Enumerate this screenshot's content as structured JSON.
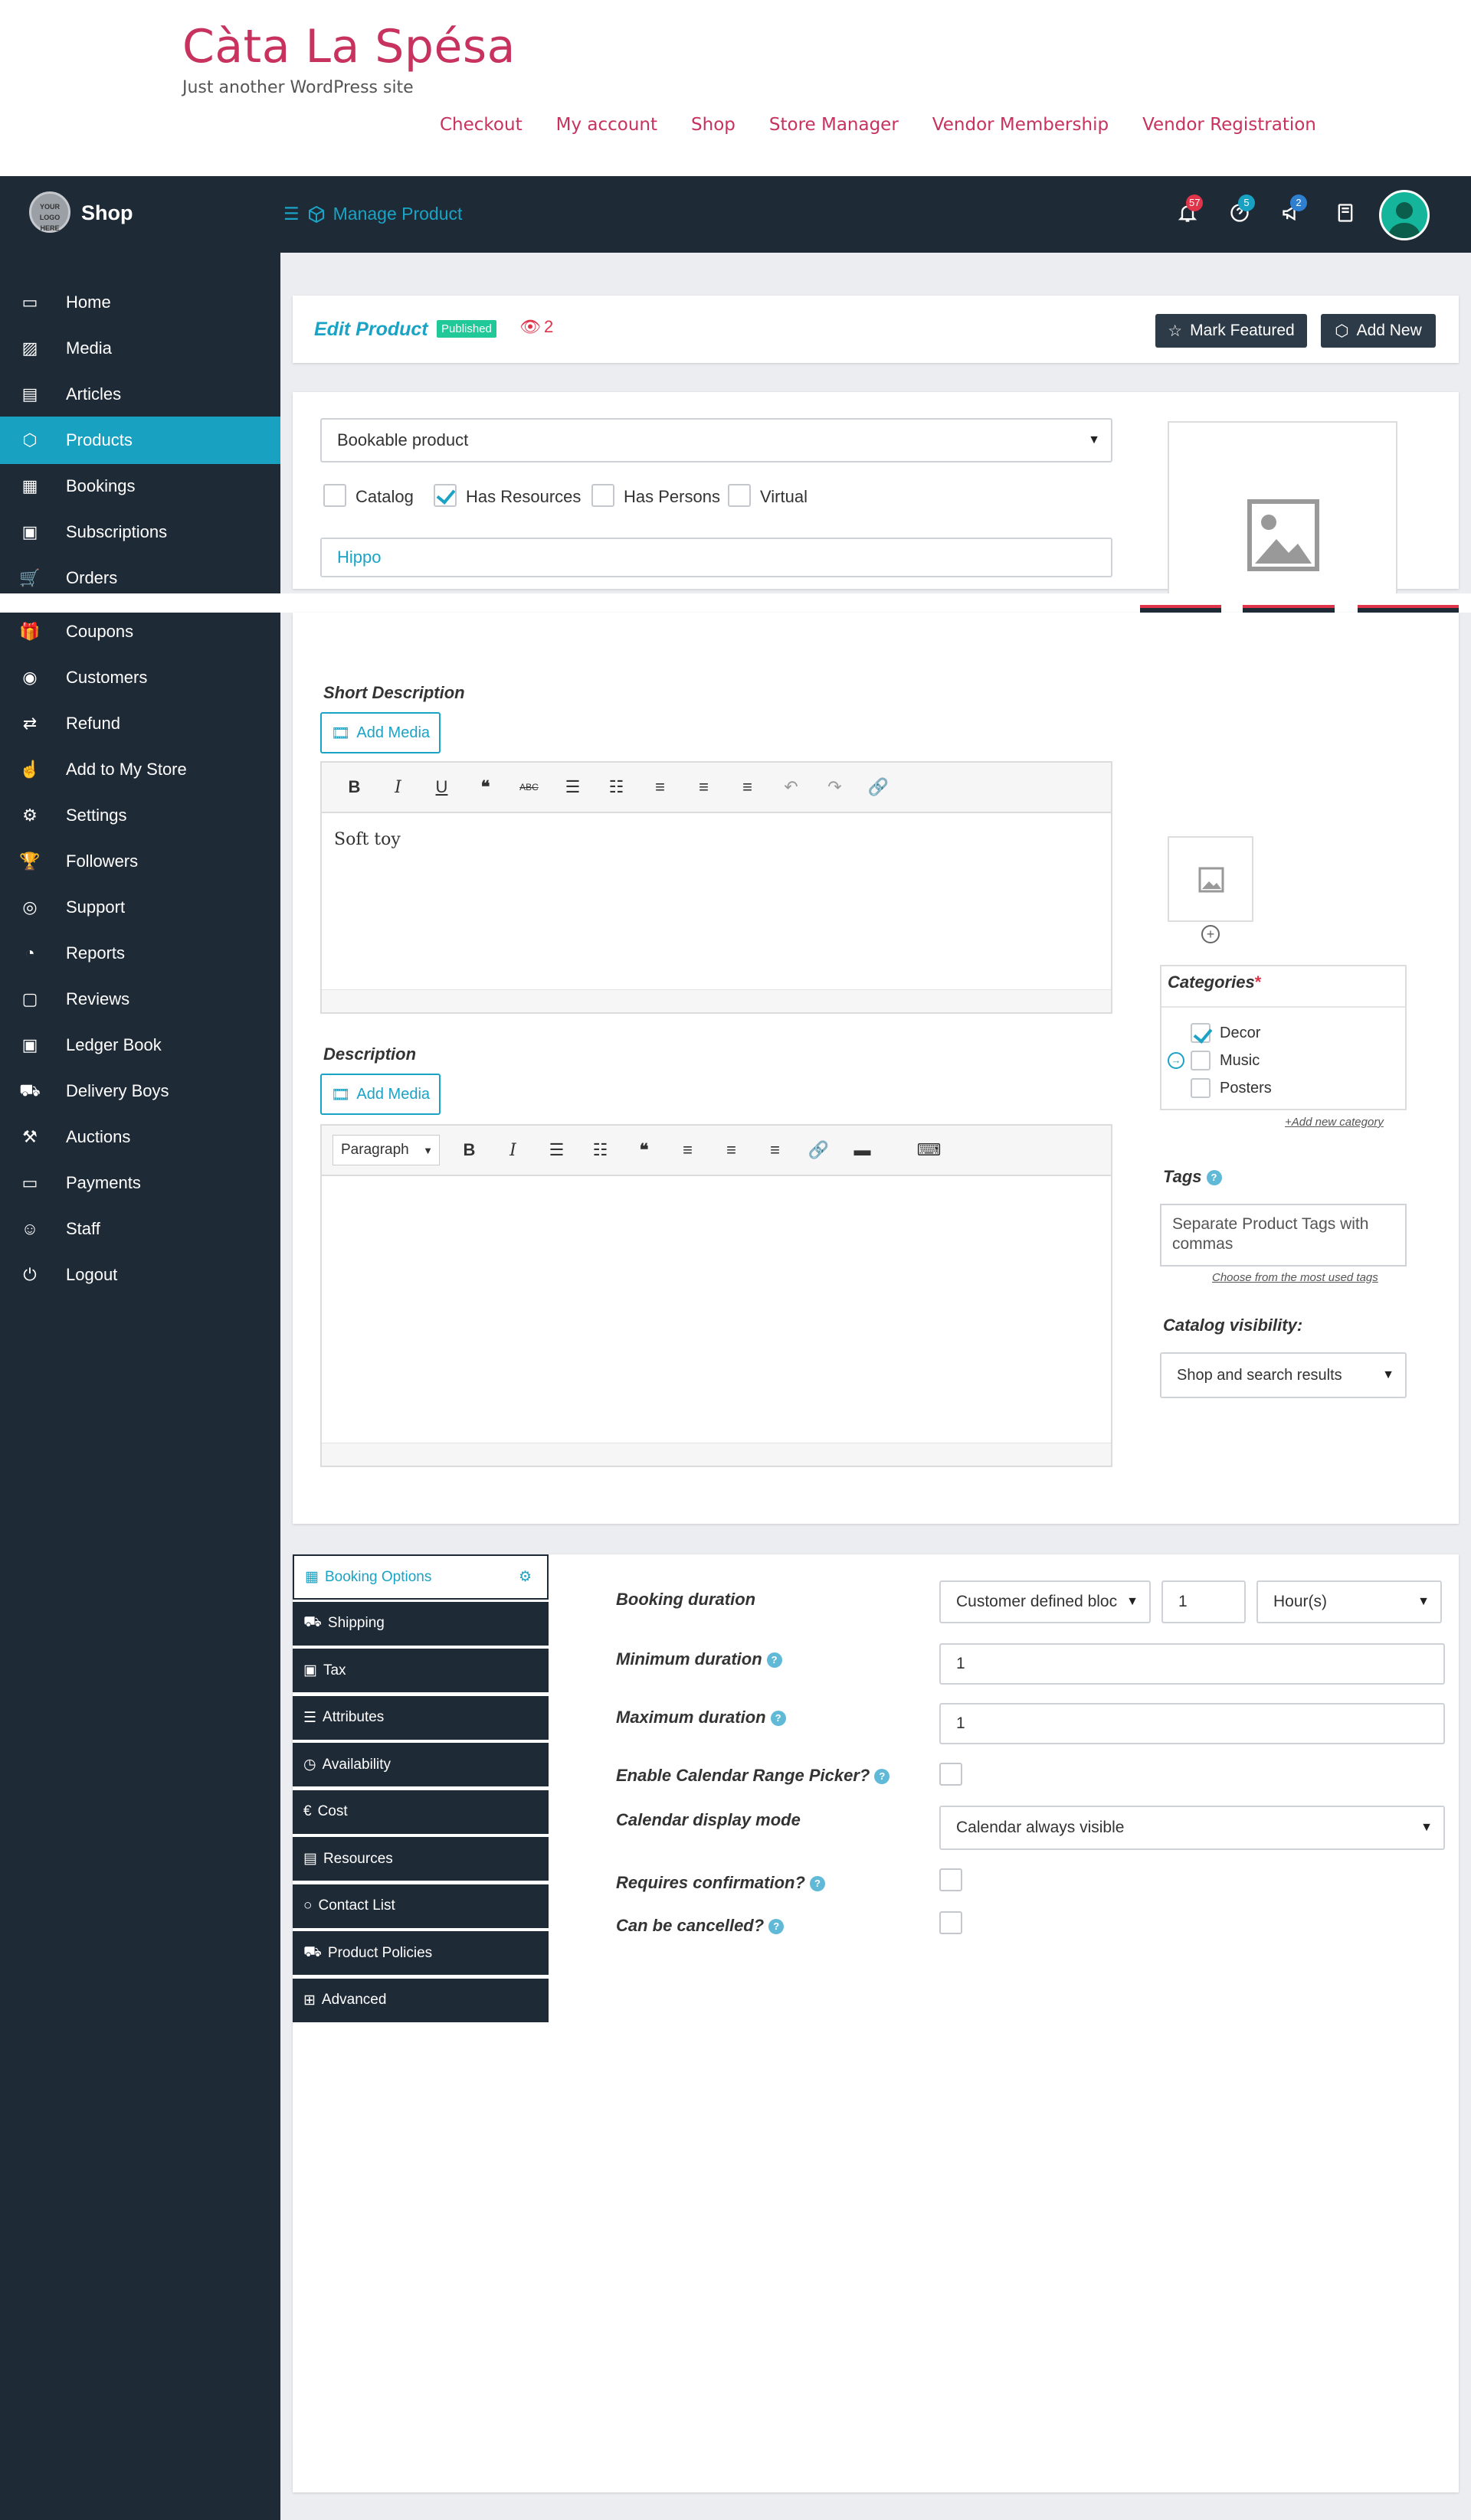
{
  "site": {
    "title": "Càta La Spésa",
    "tagline": "Just another WordPress site",
    "nav": [
      "Checkout",
      "My account",
      "Shop",
      "Store Manager",
      "Vendor Membership",
      "Vendor Registration"
    ]
  },
  "topbar": {
    "logo_text": "YOUR LOGO HERE",
    "shop_label": "Shop",
    "manage_label": "Manage Product",
    "notifications_count": "57",
    "help_count": "5",
    "announce_count": "2",
    "colors": {
      "dark": "#1f2a37",
      "accent": "#1aa3c4",
      "red": "#e0344b",
      "brand": "#c7325e"
    }
  },
  "sidebar": {
    "items": [
      {
        "label": "Home",
        "icon": "monitor-icon"
      },
      {
        "label": "Media",
        "icon": "image-icon"
      },
      {
        "label": "Articles",
        "icon": "document-icon"
      },
      {
        "label": "Products",
        "icon": "cube-icon",
        "active": true
      },
      {
        "label": "Bookings",
        "icon": "calendar-icon"
      },
      {
        "label": "Subscriptions",
        "icon": "money-icon"
      },
      {
        "label": "Orders",
        "icon": "cart-icon"
      },
      {
        "label": "Coupons",
        "icon": "gift-icon"
      },
      {
        "label": "Customers",
        "icon": "user-circle-icon"
      },
      {
        "label": "Refund",
        "icon": "retweet-icon"
      },
      {
        "label": "Add to My Store",
        "icon": "hand-icon"
      },
      {
        "label": "Settings",
        "icon": "cogs-icon"
      },
      {
        "label": "Followers",
        "icon": "trophy-icon"
      },
      {
        "label": "Support",
        "icon": "lifebuoy-icon"
      },
      {
        "label": "Reports",
        "icon": "pie-chart-icon"
      },
      {
        "label": "Reviews",
        "icon": "comment-icon"
      },
      {
        "label": "Ledger Book",
        "icon": "money-icon"
      },
      {
        "label": "Delivery Boys",
        "icon": "truck-icon"
      },
      {
        "label": "Auctions",
        "icon": "gavel-icon"
      },
      {
        "label": "Payments",
        "icon": "card-icon"
      },
      {
        "label": "Staff",
        "icon": "user-icon"
      },
      {
        "label": "Logout",
        "icon": "power-icon"
      }
    ]
  },
  "header": {
    "title": "Edit Product",
    "status": "Published",
    "views": "2",
    "mark_featured": "Mark Featured",
    "add_new": "Add New"
  },
  "product": {
    "type": "Bookable product",
    "flags": [
      {
        "label": "Catalog",
        "checked": false
      },
      {
        "label": "Has Resources",
        "checked": true
      },
      {
        "label": "Has Persons",
        "checked": false
      },
      {
        "label": "Virtual",
        "checked": false
      }
    ],
    "name": "Hippo"
  },
  "short_description": {
    "label": "Short Description",
    "add_media": "Add Media",
    "content": "Soft toy"
  },
  "description": {
    "label": "Description",
    "add_media": "Add Media",
    "format": "Paragraph",
    "content": ""
  },
  "categories": {
    "label": "Categories",
    "required_mark": "*",
    "items": [
      {
        "label": "Decor",
        "checked": true
      },
      {
        "label": "Music",
        "checked": false
      },
      {
        "label": "Posters",
        "checked": false
      }
    ],
    "add_new": "+Add new category"
  },
  "tags": {
    "label": "Tags",
    "placeholder": "Separate Product Tags with commas",
    "choose": "Choose from the most used tags"
  },
  "catalog_visibility": {
    "label": "Catalog visibility:",
    "value": "Shop and search results"
  },
  "tabs": [
    {
      "label": "Booking Options",
      "icon": "calendar-icon",
      "active": true
    },
    {
      "label": "Shipping",
      "icon": "truck-icon"
    },
    {
      "label": "Tax",
      "icon": "money-icon"
    },
    {
      "label": "Attributes",
      "icon": "server-icon"
    },
    {
      "label": "Availability",
      "icon": "clock-icon"
    },
    {
      "label": "Cost",
      "icon": "euro-icon"
    },
    {
      "label": "Resources",
      "icon": "briefcase-icon"
    },
    {
      "label": "Contact List",
      "icon": "circle-icon"
    },
    {
      "label": "Product Policies",
      "icon": "truck-icon"
    },
    {
      "label": "Advanced",
      "icon": "grid-icon"
    }
  ],
  "booking": {
    "duration_label": "Booking duration",
    "duration_type": "Customer defined blocks",
    "duration_value": "1",
    "duration_unit": "Hour(s)",
    "min_label": "Minimum duration",
    "min_value": "1",
    "max_label": "Maximum duration",
    "max_value": "1",
    "range_label": "Enable Calendar Range Picker?",
    "display_label": "Calendar display mode",
    "display_value": "Calendar always visible",
    "confirm_label": "Requires confirmation?",
    "cancel_label": "Can be cancelled?"
  }
}
